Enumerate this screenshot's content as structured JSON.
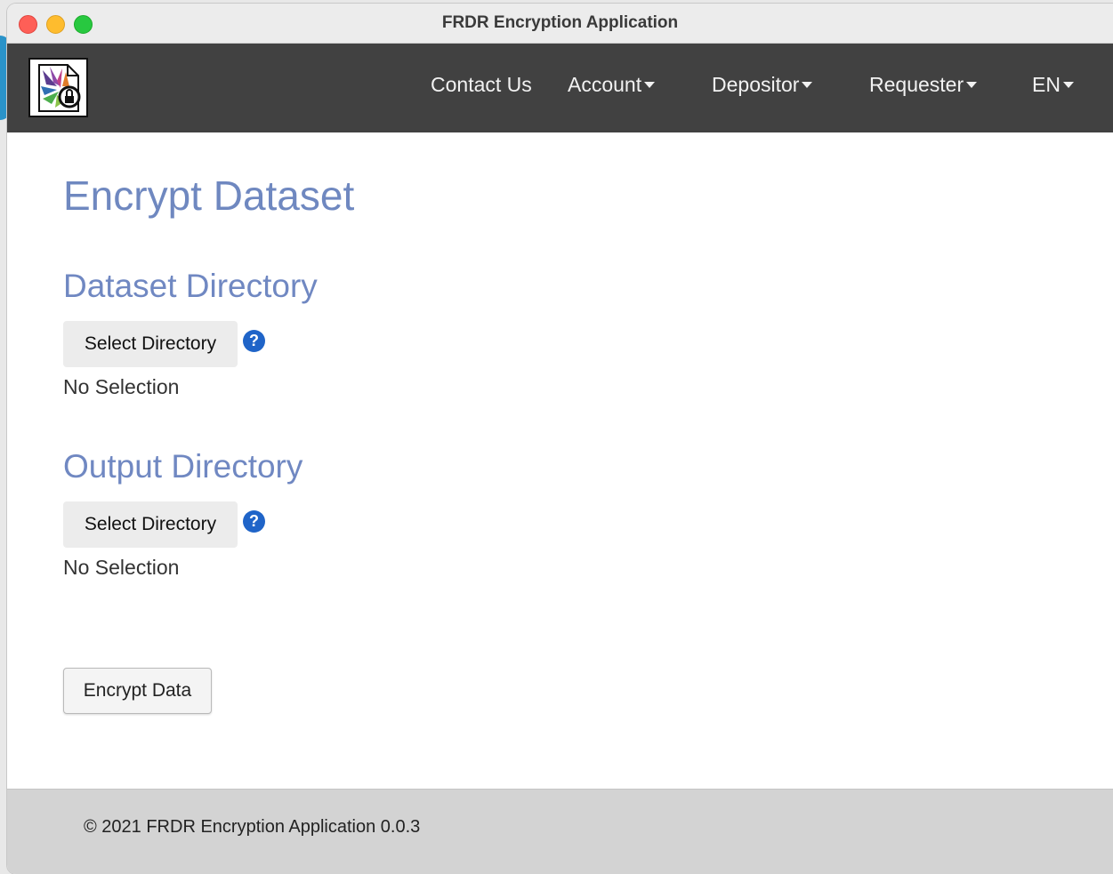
{
  "window": {
    "title": "FRDR Encryption Application"
  },
  "nav": {
    "items": [
      {
        "label": "Contact Us",
        "dropdown": false
      },
      {
        "label": "Account",
        "dropdown": true
      },
      {
        "label": "Depositor",
        "dropdown": true
      },
      {
        "label": "Requester",
        "dropdown": true
      },
      {
        "label": "EN",
        "dropdown": true
      }
    ]
  },
  "main": {
    "page_title": "Encrypt Dataset",
    "dataset_section": {
      "title": "Dataset Directory",
      "button_label": "Select Directory",
      "help_glyph": "?",
      "selection": "No Selection"
    },
    "output_section": {
      "title": "Output Directory",
      "button_label": "Select Directory",
      "help_glyph": "?",
      "selection": "No Selection"
    },
    "encrypt_button_label": "Encrypt Data"
  },
  "footer": {
    "text": "© 2021 FRDR Encryption Application 0.0.3"
  },
  "colors": {
    "navbar_bg": "#414141",
    "heading": "#6f88c0",
    "help_icon": "#1f64c8",
    "footer_bg": "#d3d3d3"
  },
  "icons": {
    "logo": "frdr-logo-lock-icon",
    "help": "help-circle-icon",
    "caret": "caret-down-icon"
  }
}
